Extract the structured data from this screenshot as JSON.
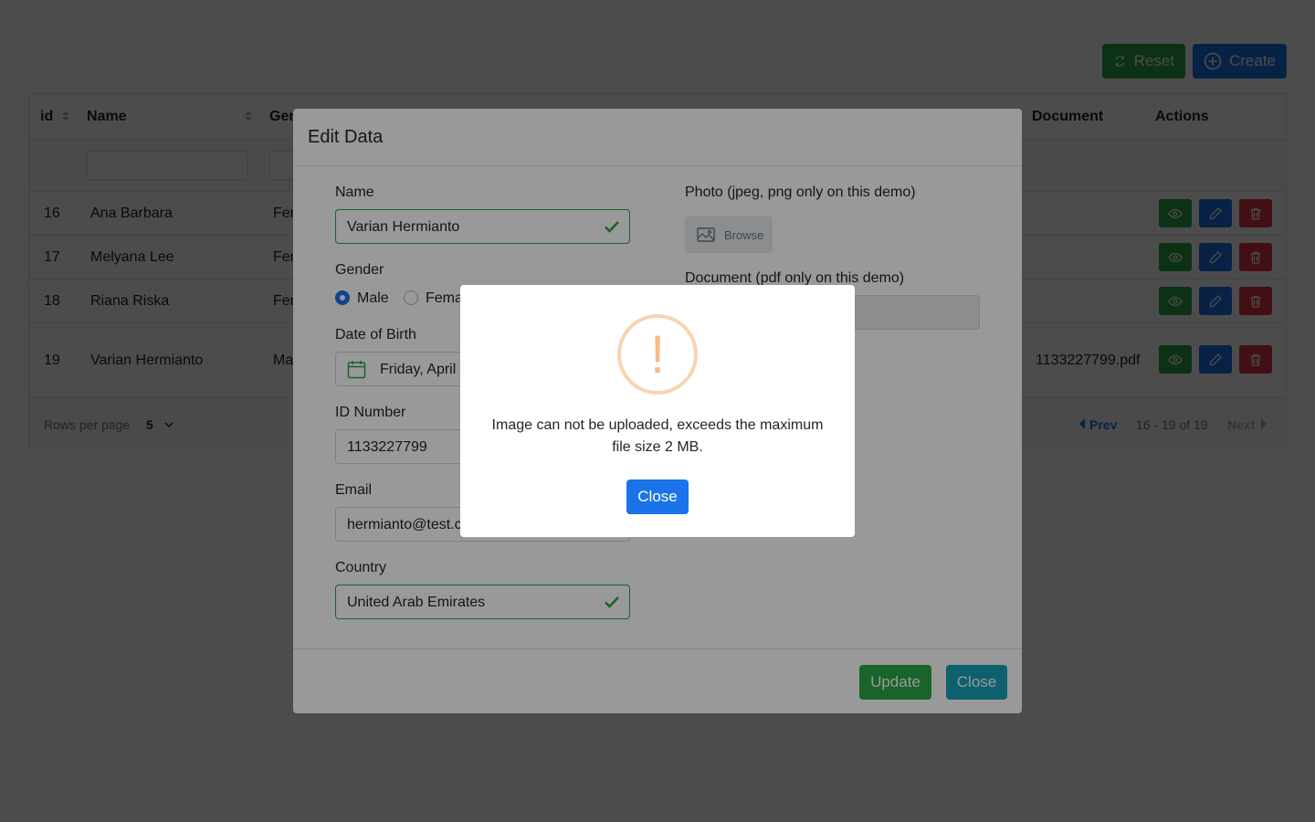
{
  "toolbar": {
    "reset_label": "Reset",
    "create_label": "Create"
  },
  "table": {
    "columns": [
      "id",
      "Name",
      "Gen",
      "Document",
      "Actions"
    ],
    "rows": [
      {
        "id": "16",
        "name": "Ana Barbara",
        "gender": "Fer",
        "document": ""
      },
      {
        "id": "17",
        "name": "Melyana Lee",
        "gender": "Fer",
        "document": ""
      },
      {
        "id": "18",
        "name": "Riana Riska",
        "gender": "Fer",
        "document": ""
      },
      {
        "id": "19",
        "name": "Varian Hermianto",
        "gender": "Ma",
        "document": "1133227799.pdf"
      }
    ],
    "footer": {
      "rows_per_page_label": "Rows per page",
      "rows_per_page_value": "5",
      "prev_label": "Prev",
      "range_text": "16 - 19 of 19",
      "next_label": "Next"
    }
  },
  "edit_modal": {
    "title": "Edit Data",
    "name_label": "Name",
    "name_value": "Varian Hermianto",
    "gender_label": "Gender",
    "gender_male": "Male",
    "gender_female": "Fema",
    "dob_label": "Date of Birth",
    "dob_value": "Friday, April",
    "id_label": "ID Number",
    "id_value": "1133227799",
    "email_label": "Email",
    "email_value": "hermianto@test.c",
    "country_label": "Country",
    "country_value": "United Arab Emirates",
    "photo_label": "Photo (jpeg, png only on this demo)",
    "browse_label": "Browse",
    "document_label": "Document (pdf only on this demo)",
    "update_label": "Update",
    "close_label": "Close"
  },
  "alert": {
    "icon_glyph": "!",
    "message": "Image can not be uploaded, exceeds the maximum file size 2 MB.",
    "close_label": "Close"
  },
  "colors": {
    "primary": "#1a73e8",
    "success": "#28a745",
    "danger": "#dc3545",
    "info": "#17a2b8",
    "warning": "#f8bb86"
  }
}
